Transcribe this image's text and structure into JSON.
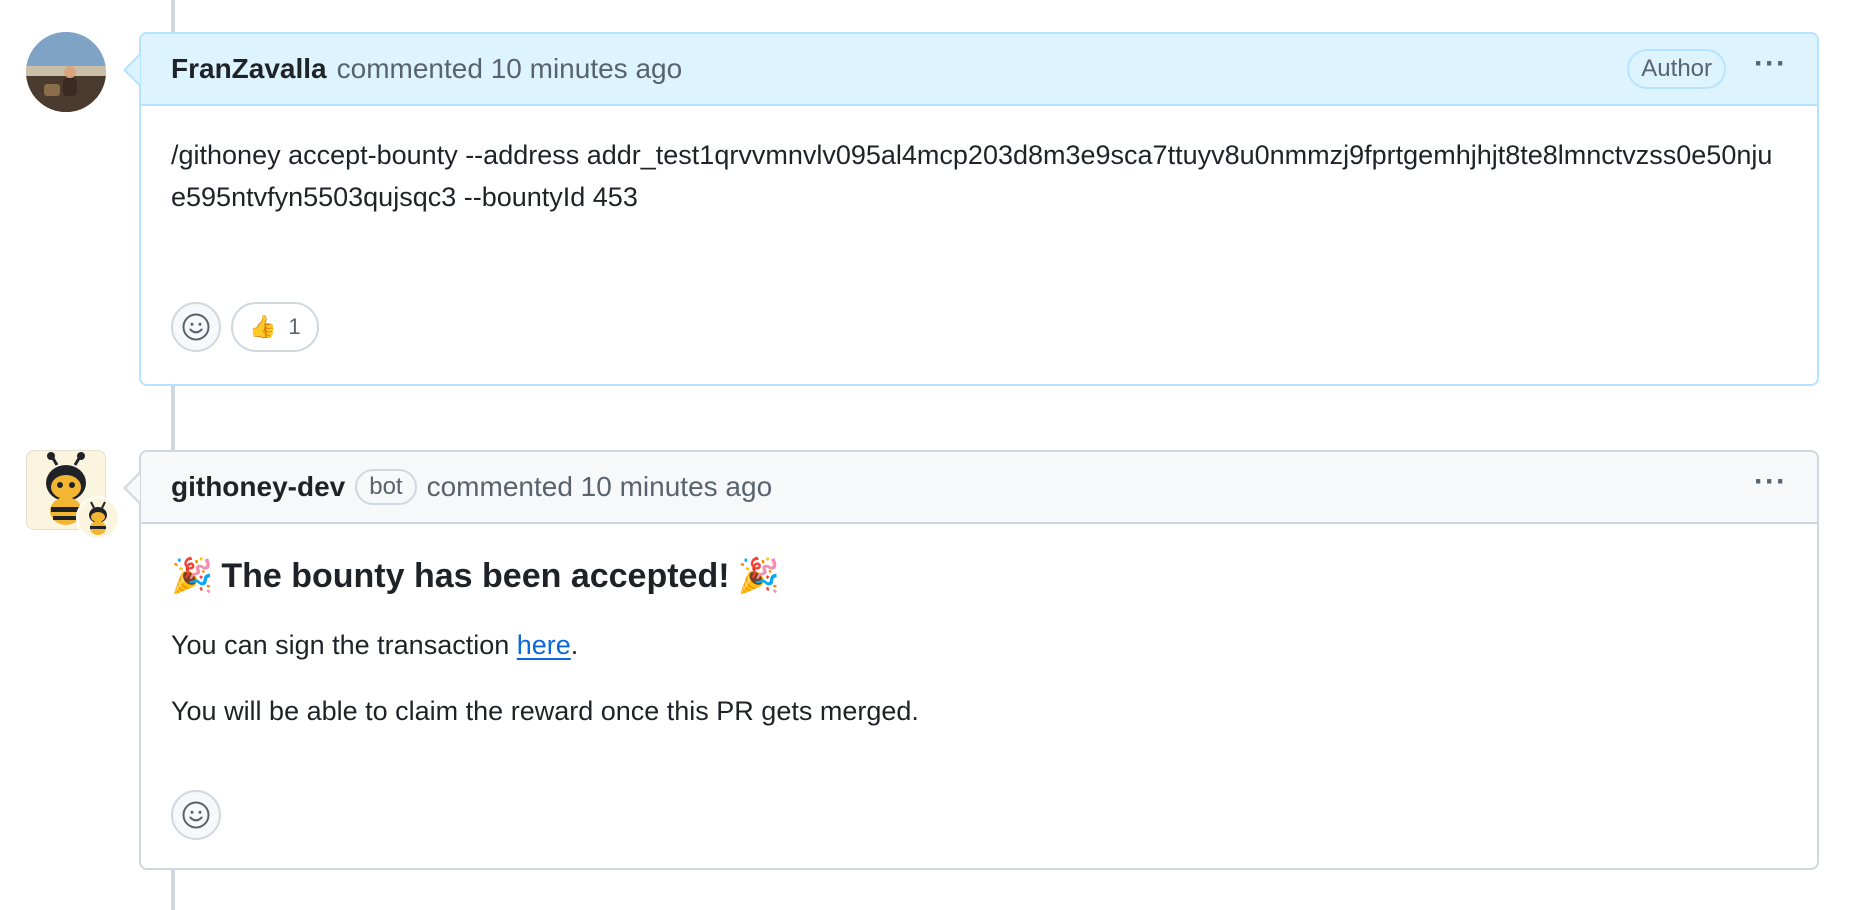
{
  "comments": [
    {
      "author": "FranZavalla",
      "meta": "commented 10 minutes ago",
      "role_label": "Author",
      "menu_label": "···",
      "body": "/githoney accept-bounty --address addr_test1qrvvmnvlv095al4mcp203d8m3e9sca7ttuyv8u0nmmzj9fprtgemhjhjt8te8lmnctvzss0e50njue595ntvfyn5503qujsqc3 --bountyId 453",
      "reactions": [
        {
          "emoji": "👍",
          "count": "1"
        }
      ]
    },
    {
      "author": "githoney-dev",
      "badge": "bot",
      "meta": "commented 10 minutes ago",
      "menu_label": "···",
      "heading_emoji": "🎉",
      "heading": "The bounty has been accepted!",
      "sign_prefix": "You can sign the transaction ",
      "sign_link": "here",
      "sign_suffix": ".",
      "claim_text": "You will be able to claim the reward once this PR gets merged."
    }
  ],
  "icons": {
    "smiley": "smiley-icon",
    "kebab": "kebab-horizontal-icon"
  },
  "colors": {
    "author_header_bg": "#ddf4ff",
    "author_border": "#b6e3ff",
    "link": "#0969da",
    "bot_header_bg": "#f6f8fa"
  }
}
